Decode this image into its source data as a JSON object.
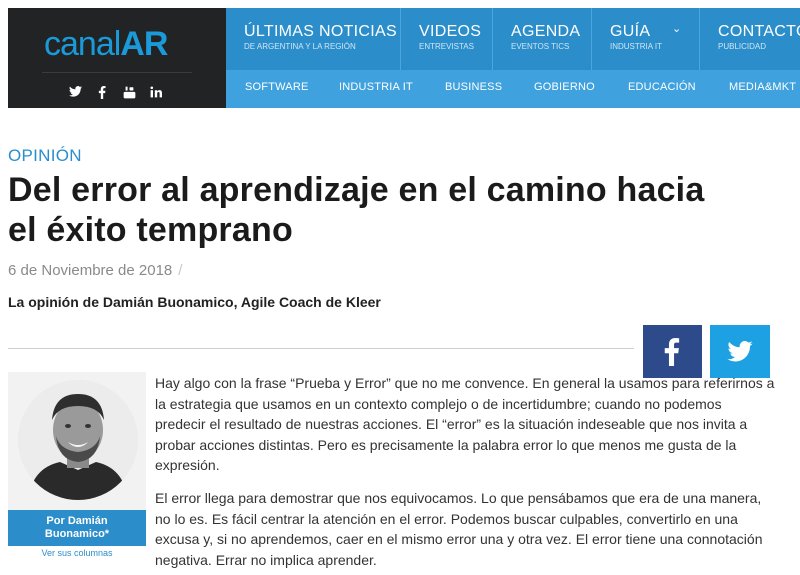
{
  "site": {
    "logo_text": "canal",
    "logo_accent": "AR",
    "social_icons": [
      "twitter-icon",
      "facebook-icon",
      "youtube-icon",
      "linkedin-icon"
    ]
  },
  "nav": {
    "main": [
      {
        "label": "ÚLTIMAS NOTICIAS",
        "sub": "DE ARGENTINA Y LA REGIÓN"
      },
      {
        "label": "VIDEOS",
        "sub": "ENTREVISTAS"
      },
      {
        "label": "AGENDA",
        "sub": "EVENTOS TICS"
      },
      {
        "label": "GUÍA",
        "sub": "INDUSTRIA IT"
      },
      {
        "label": "CONTACTO",
        "sub": "PUBLICIDAD"
      }
    ],
    "secondary": [
      "SOFTWARE",
      "INDUSTRIA IT",
      "BUSINESS",
      "GOBIERNO",
      "EDUCACIÓN",
      "MEDIA&MKT"
    ]
  },
  "article": {
    "section": "OPINIÓN",
    "title": "Del error al aprendizaje en el camino hacia el éxito temprano",
    "date": "6 de Noviembre de 2018",
    "date_separator": "/",
    "lead": "La opinión de Damián Buonamico, Agile Coach de Kleer",
    "paragraphs": [
      "Hay algo con la frase “Prueba y Error” que no me convence. En general la usamos para referirnos a la estrategia que usamos en un contexto complejo o de incertidumbre; cuando no podemos predecir el resultado de nuestras acciones. El “error” es la situación indeseable que nos invita a probar acciones distintas. Pero es precisamente la palabra error lo que menos me gusta de la expresión.",
      "El error llega para demostrar que nos equivocamos. Lo que pensábamos que era de una manera, no lo es. Es fácil centrar la atención en el error. Podemos buscar culpables, convertirlo en una excusa y, si no aprendemos, caer en el mismo error una y otra vez. El error tiene una connotación negativa. Errar no implica aprender."
    ]
  },
  "share": {
    "facebook_icon": "facebook-icon",
    "twitter_icon": "twitter-icon",
    "facebook_color": "#2d4a8a",
    "twitter_color": "#1da1e2"
  },
  "author": {
    "name_line1": "Por Damián",
    "name_line2": "Buonamico*",
    "link": "Ver sus columnas"
  },
  "colors": {
    "accent": "#2b8ecb",
    "nav_secondary": "#3fa2de",
    "logo_bg": "#222324"
  }
}
